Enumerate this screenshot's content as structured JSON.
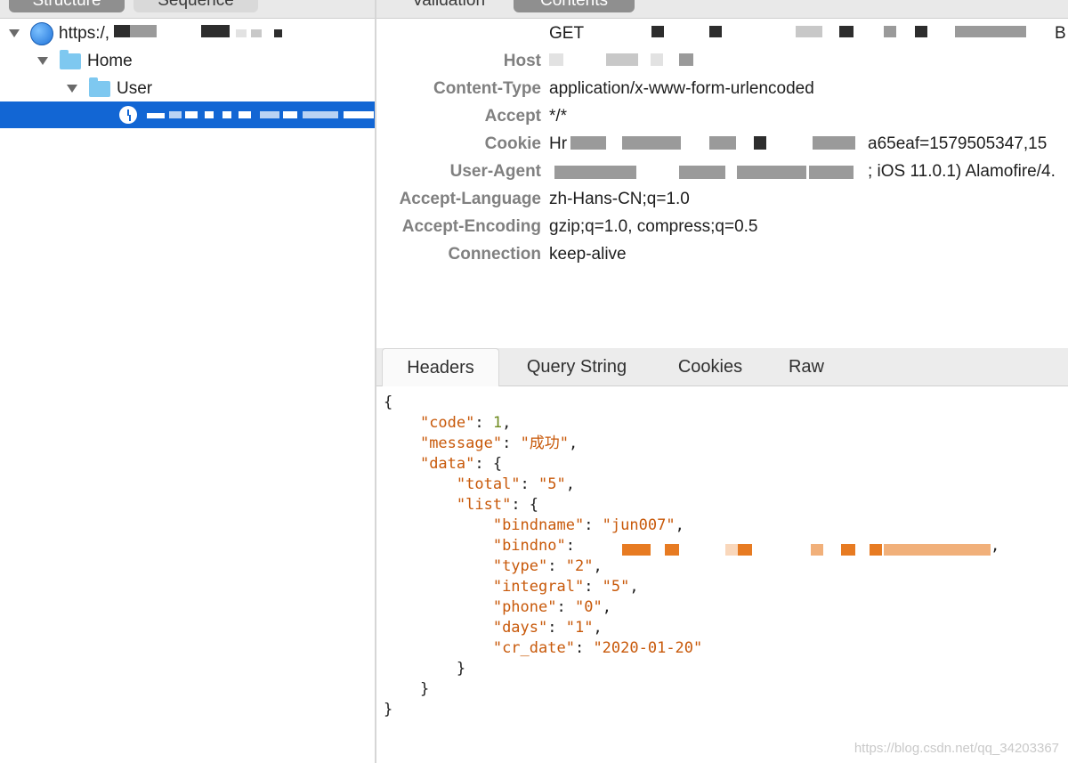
{
  "left_tabs": {
    "structure": "Structure",
    "sequence": "Sequence"
  },
  "right_tabs": {
    "validation": "Validation",
    "contents": "Contents"
  },
  "tree": {
    "root_label": "https:/,",
    "home_label": "Home",
    "user_label": "User"
  },
  "request_headers": [
    {
      "key": "",
      "value": "GET"
    },
    {
      "key": "Host",
      "value": ""
    },
    {
      "key": "Content-Type",
      "value": "application/x-www-form-urlencoded"
    },
    {
      "key": "Accept",
      "value": "*/*"
    },
    {
      "key": "Cookie",
      "value": "Hr",
      "value_tail": "a65eaf=1579505347,15"
    },
    {
      "key": "User-Agent",
      "value": "",
      "value_tail": "; iOS 11.0.1) Alamofire/4."
    },
    {
      "key": "Accept-Language",
      "value": "zh-Hans-CN;q=1.0"
    },
    {
      "key": "Accept-Encoding",
      "value": "gzip;q=1.0, compress;q=0.5"
    },
    {
      "key": "Connection",
      "value": "keep-alive"
    }
  ],
  "response_tabs": [
    "Headers",
    "Query String",
    "Cookies",
    "Raw"
  ],
  "json_body": {
    "open": "{",
    "code_key": "\"code\"",
    "code_val": "1",
    "message_key": "\"message\"",
    "message_val": "\"成功\"",
    "data_key": "\"data\"",
    "total_key": "\"total\"",
    "total_val": "\"5\"",
    "list_key": "\"list\"",
    "bindname_key": "\"bindname\"",
    "bindname_val": "\"jun007\"",
    "bindno_key": "\"bindno\"",
    "type_key": "\"type\"",
    "type_val": "\"2\"",
    "integral_key": "\"integral\"",
    "integral_val": "\"5\"",
    "phone_key": "\"phone\"",
    "phone_val": "\"0\"",
    "days_key": "\"days\"",
    "days_val": "\"1\"",
    "cr_date_key": "\"cr_date\"",
    "cr_date_val": "\"2020-01-20\""
  },
  "watermark": "https://blog.csdn.net/qq_34203367",
  "colors": {
    "selection": "#1266d4",
    "json_key": "#c8590a",
    "json_number": "#6e8a1e",
    "header_key": "#808080"
  }
}
